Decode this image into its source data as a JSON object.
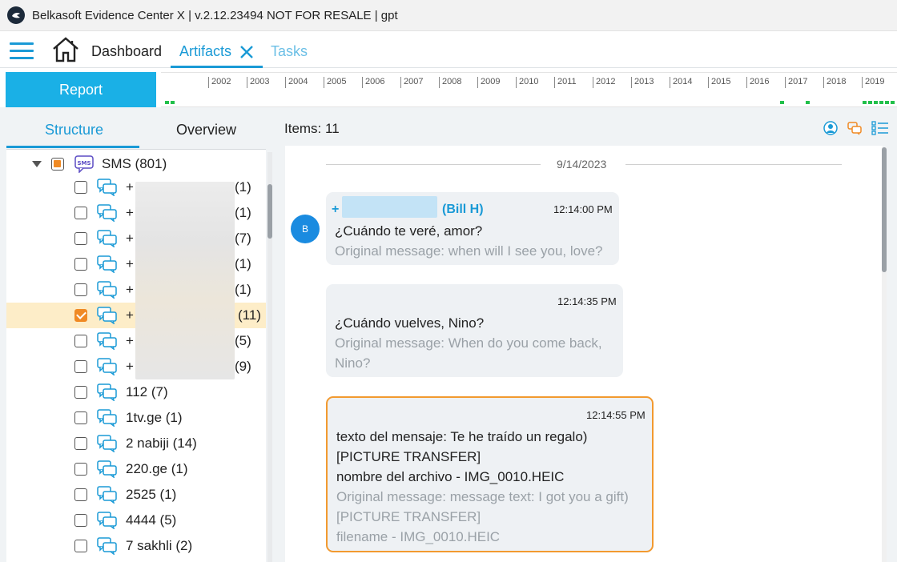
{
  "window": {
    "title": "Belkasoft Evidence Center X | v.2.12.23494 NOT FOR RESALE | gpt"
  },
  "nav": {
    "tabs": [
      {
        "label": "Dashboard"
      },
      {
        "label": "Artifacts"
      },
      {
        "label": "Tasks"
      }
    ]
  },
  "toolbar": {
    "report_label": "Report"
  },
  "timeline": {
    "years": [
      "2002",
      "2003",
      "2004",
      "2005",
      "2006",
      "2007",
      "2008",
      "2009",
      "2010",
      "2011",
      "2012",
      "2013",
      "2014",
      "2015",
      "2016",
      "2017",
      "2018",
      "2019"
    ]
  },
  "left_panel": {
    "tabs": [
      {
        "label": "Structure"
      },
      {
        "label": "Overview"
      }
    ],
    "tree": {
      "root": {
        "label": "SMS (801)",
        "icon": "sms-icon",
        "state": "partial"
      },
      "children": [
        {
          "prefix": "+",
          "count": "(1)",
          "checked": false
        },
        {
          "prefix": "+",
          "count": "(1)",
          "checked": false
        },
        {
          "prefix": "+",
          "count": "(7)",
          "checked": false
        },
        {
          "prefix": "+",
          "count": "(1)",
          "checked": false
        },
        {
          "prefix": "+",
          "count": "(1)",
          "checked": false
        },
        {
          "prefix": "+",
          "count": "(11)",
          "checked": true
        },
        {
          "prefix": "+",
          "count": "(5)",
          "checked": false
        },
        {
          "prefix": "+",
          "count": "(9)",
          "checked": false
        },
        {
          "label": "112 (7)",
          "checked": false
        },
        {
          "label": "1tv.ge (1)",
          "checked": false
        },
        {
          "label": "2 nabiji (14)",
          "checked": false
        },
        {
          "label": "220.ge (1)",
          "checked": false
        },
        {
          "label": "2525 (1)",
          "checked": false
        },
        {
          "label": "4444 (5)",
          "checked": false
        },
        {
          "label": "7 sakhli (2)",
          "checked": false
        }
      ]
    }
  },
  "right_panel": {
    "items_label": "Items: 11",
    "date_separator": "9/14/2023",
    "messages": [
      {
        "avatar": "B",
        "sender_prefix": "+",
        "sender_name": "(Bill H)",
        "time": "12:14:00 PM",
        "text_lines": [
          "¿Cuándo te veré, amor?"
        ],
        "original_lines": [
          "Original message: when will I see you, love?"
        ]
      },
      {
        "time": "12:14:35 PM",
        "text_lines": [
          "¿Cuándo vuelves, Nino?"
        ],
        "original_lines": [
          "Original message: When do you come back,",
          "Nino?"
        ]
      },
      {
        "time": "12:14:55 PM",
        "text_lines": [
          "texto del mensaje: Te he traído un regalo)",
          "[PICTURE TRANSFER]",
          "nombre del archivo - IMG_0010.HEIC"
        ],
        "original_lines": [
          "Original message: message text: I got you a gift)",
          "[PICTURE TRANSFER]",
          "filename - IMG_0010.HEIC"
        ]
      }
    ]
  },
  "colors": {
    "accent": "#1a9ad6",
    "report_bg": "#1ab0e6",
    "highlight_border": "#f29a30",
    "selected_row": "#fdedc8",
    "checkbox": "#f08a24"
  }
}
